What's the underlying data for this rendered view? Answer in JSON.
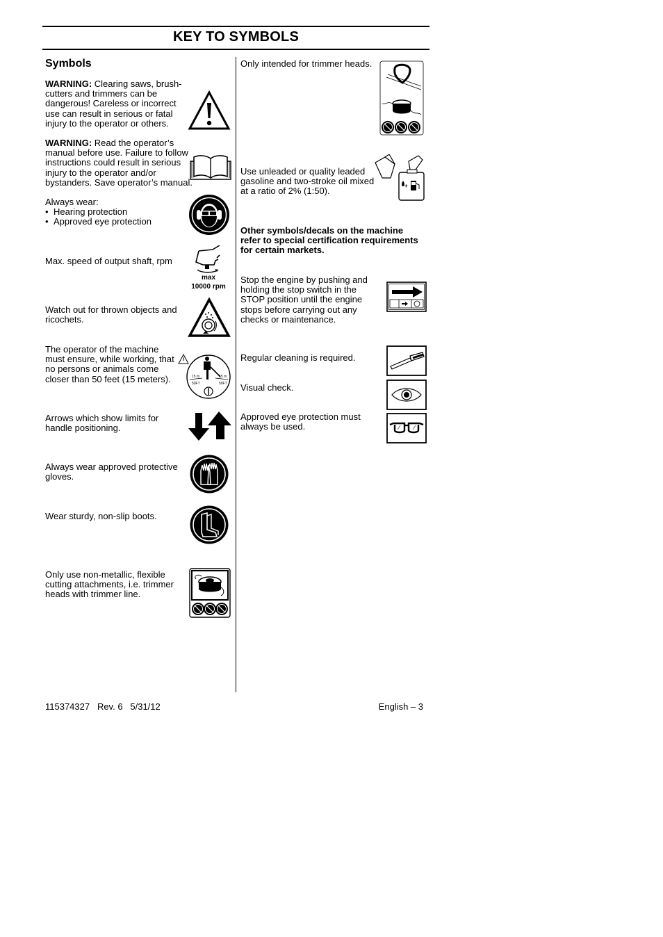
{
  "header": {
    "title": "KEY TO SYMBOLS"
  },
  "section": {
    "heading": "Symbols"
  },
  "left_column": {
    "items": [
      {
        "label_bold": "WARNING:",
        "text": " Clearing saws, brush-cutters and trimmers can be dangerous! Careless or incorrect use can result in serious or fatal injury to the operator or others.",
        "icon": "warning-triangle-icon"
      },
      {
        "label_bold": "WARNING:",
        "text": "  Read the operator’s manual before use. Failure to follow instructions could result in serious injury to the operator and/or bystanders. Save operator’s manual.",
        "icon": "open-book-icon"
      },
      {
        "text": "Always wear:",
        "bullets": [
          "Hearing protection",
          "Approved eye protection"
        ],
        "icon": "ear-eye-protection-icon"
      },
      {
        "text": "Max. speed of output shaft, rpm",
        "icon": "output-shaft-icon",
        "icon_caption_1": "max",
        "icon_caption_2": "10000 rpm"
      },
      {
        "text": "Watch out for thrown objects and ricochets.",
        "icon": "thrown-objects-icon"
      },
      {
        "text": "The operator of the machine must ensure, while working, that no persons or animals come closer than 50 feet (15 meters).",
        "icon": "safety-distance-icon",
        "icon_labels": [
          "15 m",
          "50FT",
          "15 m",
          "50FT"
        ]
      },
      {
        "text": "Arrows which show limits for handle positioning.",
        "icon": "handle-limit-arrows-icon"
      },
      {
        "text": "Always wear approved protective gloves.",
        "icon": "gloves-icon"
      },
      {
        "text": "Wear sturdy, non-slip boots.",
        "icon": "boots-icon"
      },
      {
        "text": "Only use non-metallic, flexible cutting attachments, i.e. trimmer heads with trimmer line.",
        "icon": "trimmer-head-decal-icon"
      }
    ]
  },
  "right_column": {
    "items": [
      {
        "text": "Only intended for trimmer heads.",
        "icon": "trimmer-heads-only-icon"
      },
      {
        "text": "Use unleaded or quality leaded gasoline and two-stroke oil mixed at a ratio of 2% (1:50).",
        "icon": "fuel-mix-icon"
      },
      {
        "text_bold": "Other symbols/decals on the machine refer to special certification requirements for certain markets."
      },
      {
        "text": "Stop the engine by pushing and holding the stop switch in the STOP position until the engine stops before carrying out any checks or maintenance.",
        "icon": "stop-switch-icon"
      },
      {
        "text": "Regular cleaning is required.",
        "icon": "cleaning-brush-icon"
      },
      {
        "text": "Visual check.",
        "icon": "eye-icon"
      },
      {
        "text": "Approved eye protection must always be used.",
        "icon": "safety-glasses-icon"
      }
    ]
  },
  "footer": {
    "doc_info": "115374327   Rev. 6   5/31/12",
    "page_label": "English – 3"
  }
}
